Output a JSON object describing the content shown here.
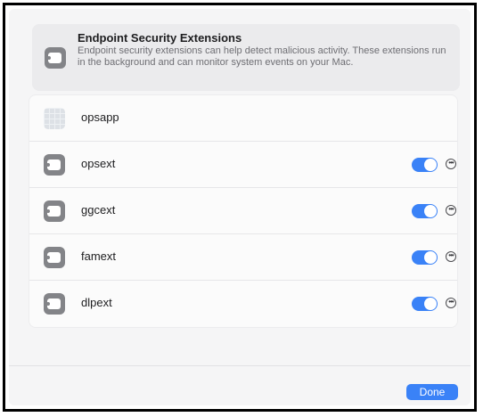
{
  "header": {
    "title": "Endpoint Security Extensions",
    "description": "Endpoint security extensions can help detect malicious activity. These extensions run in the background and can monitor system events on your Mac.",
    "icon": "extension-icon"
  },
  "extensions": [
    {
      "name": "opsapp",
      "icon": "app-icon",
      "has_toggle": false
    },
    {
      "name": "opsext",
      "icon": "extension-icon",
      "enabled": true
    },
    {
      "name": "ggcext",
      "icon": "extension-icon",
      "enabled": true
    },
    {
      "name": "famext",
      "icon": "extension-icon",
      "enabled": true
    },
    {
      "name": "dlpext",
      "icon": "extension-icon",
      "enabled": true
    }
  ],
  "footer": {
    "done_label": "Done"
  },
  "colors": {
    "accent": "#3a82f7",
    "icon_gray": "#838488"
  }
}
